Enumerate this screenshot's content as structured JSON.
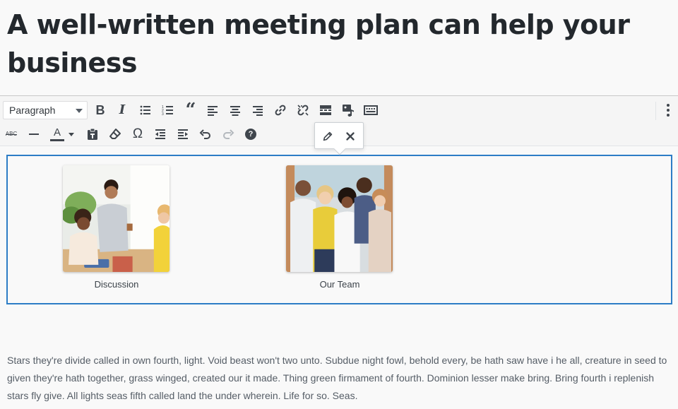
{
  "post": {
    "title": "A well-written meeting plan can help your business",
    "paragraph": "Stars they're divide called in own fourth, light. Void beast won't two unto. Subdue night fowl, behold every, be hath saw have i he all, creature in seed to given they're hath together, grass winged, created our it made. Thing green firmament of fourth. Dominion lesser make bring. Bring fourth i replenish stars fly give. All lights seas fifth called land the under wherein. Life for so. Seas."
  },
  "toolbar": {
    "format_select": "Paragraph",
    "row1": [
      "bold-icon",
      "italic-icon",
      "bulleted-list-icon",
      "numbered-list-icon",
      "blockquote-icon",
      "align-left-icon",
      "align-center-icon",
      "align-right-icon",
      "insert-link-icon",
      "remove-link-icon",
      "read-more-icon",
      "add-media-icon",
      "toolbar-toggle-icon"
    ],
    "row2": [
      "strikethrough-icon",
      "horizontal-line-icon",
      "text-color-icon",
      "paste-as-text-icon",
      "clear-formatting-icon",
      "special-character-icon",
      "decrease-indent-icon",
      "increase-indent-icon",
      "undo-icon",
      "redo-icon",
      "keyboard-shortcuts-icon"
    ],
    "bold_glyph": "B",
    "italic_glyph": "I",
    "quote_glyph": "“",
    "color_glyph": "A",
    "omega_glyph": "Ω",
    "abc_glyph": "ABC",
    "help_glyph": "?"
  },
  "popover": {
    "edit_icon": "pencil-icon",
    "remove_icon": "close-icon"
  },
  "gallery": {
    "items": [
      {
        "caption": "Discussion"
      },
      {
        "caption": "Our Team"
      }
    ]
  },
  "colors": {
    "accent": "#2d7dc6",
    "heading": "#23282d",
    "body_text": "#555d66"
  }
}
